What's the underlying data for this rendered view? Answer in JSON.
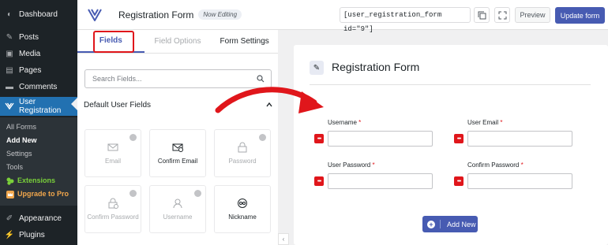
{
  "wp_sidebar": {
    "items": [
      {
        "label": "Dashboard",
        "icon": "dashboard-icon"
      },
      {
        "label": "Posts",
        "icon": "pin-icon"
      },
      {
        "label": "Media",
        "icon": "media-icon"
      },
      {
        "label": "Pages",
        "icon": "page-icon"
      },
      {
        "label": "Comments",
        "icon": "comment-icon"
      },
      {
        "label": "User Registration",
        "icon": "user-registration-icon"
      }
    ],
    "submenu": [
      {
        "label": "All Forms"
      },
      {
        "label": "Add New"
      },
      {
        "label": "Settings"
      },
      {
        "label": "Tools"
      },
      {
        "label": "Extensions"
      },
      {
        "label": "Upgrade to Pro"
      }
    ],
    "bottom_items": [
      {
        "label": "Appearance",
        "icon": "brush-icon"
      },
      {
        "label": "Plugins",
        "icon": "plug-icon"
      }
    ]
  },
  "topbar": {
    "title": "Registration Form",
    "badge": "Now Editing",
    "shortcode": "[user_registration_form id=\"9\"]",
    "preview_label": "Preview",
    "update_label": "Update form"
  },
  "panel": {
    "tabs": [
      "Fields",
      "Field Options",
      "Form Settings"
    ],
    "search_placeholder": "Search Fields...",
    "section_title": "Default User Fields",
    "fields": [
      {
        "label": "Email",
        "icon": "envelope-icon",
        "locked": true
      },
      {
        "label": "Confirm Email",
        "icon": "envelope-check-icon",
        "locked": false
      },
      {
        "label": "Password",
        "icon": "lock-icon",
        "locked": true
      },
      {
        "label": "Confirm Password",
        "icon": "lock-check-icon",
        "locked": true
      },
      {
        "label": "Username",
        "icon": "user-icon",
        "locked": true
      },
      {
        "label": "Nickname",
        "icon": "nickname-icon",
        "locked": false
      }
    ]
  },
  "builder": {
    "title": "Registration Form",
    "fields": [
      {
        "label": "Username",
        "required": "*"
      },
      {
        "label": "User Email",
        "required": "*"
      },
      {
        "label": "User Password",
        "required": "*"
      },
      {
        "label": "Confirm Password",
        "required": "*"
      }
    ],
    "add_new_label": "Add New"
  },
  "colors": {
    "accent": "#475bb2",
    "highlight": "#e0161b",
    "wp_sidebar": "#1d2327",
    "wp_active": "#2271b1"
  }
}
